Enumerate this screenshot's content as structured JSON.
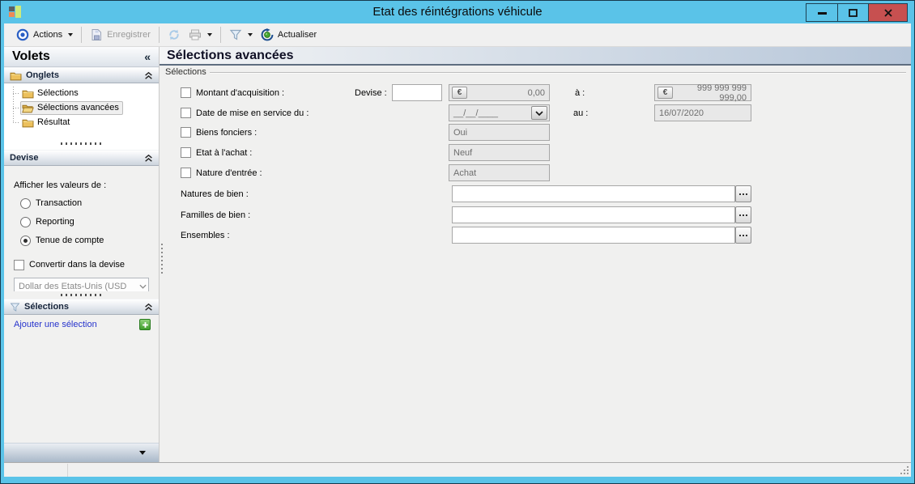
{
  "window": {
    "title": "Etat des réintégrations véhicule"
  },
  "toolbar": {
    "actions_label": "Actions",
    "save_label": "Enregistrer",
    "refresh_label": "Actualiser"
  },
  "sidebar": {
    "title": "Volets",
    "collapse_glyph": "«",
    "onglets": {
      "label": "Onglets",
      "items": [
        {
          "label": "Sélections",
          "selected": false
        },
        {
          "label": "Sélections avancées",
          "selected": true
        },
        {
          "label": "Résultat",
          "selected": false
        }
      ]
    },
    "devise": {
      "label": "Devise",
      "show_values_label": "Afficher les valeurs de :",
      "options": [
        {
          "label": "Transaction",
          "selected": false
        },
        {
          "label": "Reporting",
          "selected": false
        },
        {
          "label": "Tenue de compte",
          "selected": true
        }
      ],
      "convert_label": "Convertir dans la devise",
      "currency_value": "Dollar des Etats-Unis (USD"
    },
    "selections": {
      "label": "Sélections",
      "add_link_label": "Ajouter une sélection"
    }
  },
  "main": {
    "title": "Sélections avancées",
    "group_label": "Sélections",
    "eur_symbol": "€",
    "rows": {
      "montant": {
        "label": "Montant d'acquisition :",
        "checked": false,
        "devise_label": "Devise :",
        "devise_value": "",
        "from_value": "0,00",
        "to_label": "à :",
        "to_value": "999 999 999 999,00"
      },
      "date_service": {
        "label": "Date de mise en service du :",
        "checked": false,
        "from_value": "__/__/____",
        "to_label": "au :",
        "to_value": "16/07/2020"
      },
      "biens_fonciers": {
        "label": "Biens fonciers :",
        "checked": false,
        "value": "Oui"
      },
      "etat_achat": {
        "label": "Etat à l'achat :",
        "checked": false,
        "value": "Neuf"
      },
      "nature_entree": {
        "label": "Nature d'entrée :",
        "checked": false,
        "value": "Achat"
      },
      "natures_bien": {
        "label": "Natures de bien :",
        "value": ""
      },
      "familles_bien": {
        "label": "Familles de bien :",
        "value": ""
      },
      "ensembles": {
        "label": "Ensembles :",
        "value": ""
      }
    }
  },
  "colors": {
    "titlebar_blue": "#5ac3e8",
    "close_red": "#c75050",
    "header_gradient_right": "#b6c6d9",
    "link_blue": "#2633cc",
    "folder_yellow": "#ecc05c"
  }
}
